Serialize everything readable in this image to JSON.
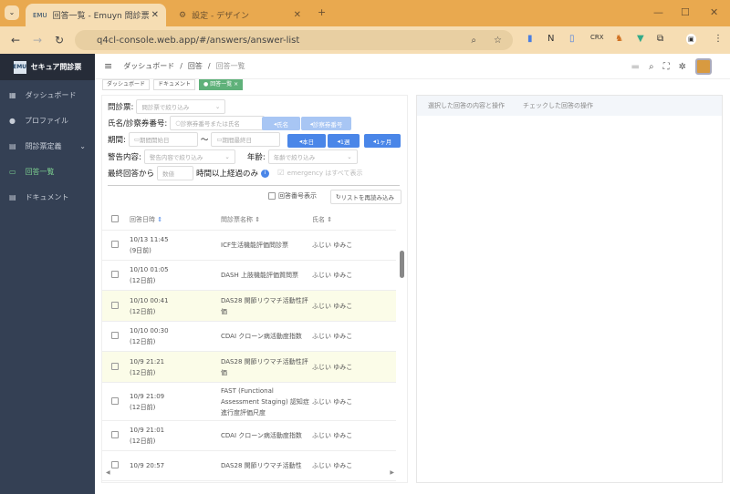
{
  "browser": {
    "tabs": [
      {
        "title": "回答一覧 - Emuyn 問診票",
        "active": true
      },
      {
        "title": "設定 - デザイン",
        "active": false
      }
    ],
    "url": "q4cl-console.web.app/#/answers/answer-list"
  },
  "sidebar": {
    "brand": "セキュア問診票",
    "logo_text": "EMUYN",
    "items": [
      {
        "label": "ダッシュボード",
        "icon": "dashboard-icon"
      },
      {
        "label": "プロファイル",
        "icon": "person-icon"
      },
      {
        "label": "問診票定義",
        "icon": "clipboard-icon"
      },
      {
        "label": "回答一覧",
        "icon": "inbox-icon",
        "active": true
      },
      {
        "label": "ドキュメント",
        "icon": "document-icon"
      }
    ]
  },
  "header": {
    "breadcrumb": [
      "ダッシュボード",
      "回答",
      "回答一覧"
    ]
  },
  "tags": [
    "ダッシュボード",
    "ドキュメント",
    "回答一覧"
  ],
  "filters": {
    "form_label": "問診票:",
    "form_placeholder": "問診票で絞り込み",
    "name_label": "氏名/診察券番号:",
    "name_placeholder": "診察券番号または氏名",
    "btn_name": "氏名",
    "btn_card": "診察券番号",
    "period_label": "期間:",
    "start_placeholder": "期間開始日",
    "tilde": "〜",
    "end_placeholder": "期間最終日",
    "btn_today": "本日",
    "btn_week": "1週",
    "btn_month": "1ヶ月",
    "warning_label": "警告内容:",
    "warning_placeholder": "警告内容で絞り込み",
    "age_label": "年齢:",
    "age_placeholder": "年齢で絞り込み",
    "last_label": "最終回答から",
    "last_placeholder": "数値",
    "hours_label": "時間以上経過のみ",
    "emergency_label": "emergency はすべて表示",
    "show_number": "回答番号表示",
    "reload": "リストを再読み込み"
  },
  "table": {
    "headers": [
      "回答日時",
      "問診票名称",
      "氏名"
    ],
    "rows": [
      {
        "date": "10/13 11:45",
        "ago": "(9日前)",
        "form": "ICF生活機能評価問診票",
        "name": "ふじい ゆみこ",
        "hl": false
      },
      {
        "date": "10/10 01:05",
        "ago": "(12日前)",
        "form": "DASH 上肢機能評価質問票",
        "name": "ふじい ゆみこ",
        "hl": false
      },
      {
        "date": "10/10 00:41",
        "ago": "(12日前)",
        "form": "DAS28 関節リウマチ活動性評価",
        "name": "ふじい ゆみこ",
        "hl": true
      },
      {
        "date": "10/10 00:30",
        "ago": "(12日前)",
        "form": "CDAI クローン病活動度指数",
        "name": "ふじい ゆみこ",
        "hl": false
      },
      {
        "date": "10/9 21:21",
        "ago": "(12日前)",
        "form": "DAS28 関節リウマチ活動性評価",
        "name": "ふじい ゆみこ",
        "hl": true
      },
      {
        "date": "10/9 21:09",
        "ago": "(12日前)",
        "form": "FAST (Functional Assessment Staging) 認知症進行度評価尺度",
        "name": "ふじい ゆみこ",
        "hl": false
      },
      {
        "date": "10/9 21:01",
        "ago": "(12日前)",
        "form": "CDAI クローン病活動度指数",
        "name": "ふじい ゆみこ",
        "hl": false
      },
      {
        "date": "10/9 20:57",
        "ago": "",
        "form": "DAS28 関節リウマチ活動性",
        "name": "ふじい ゆみこ",
        "hl": false
      }
    ]
  },
  "right_panel": {
    "tabs": [
      "選択した回答の内容と操作",
      "チェックした回答の操作"
    ]
  },
  "colors": {
    "tabbar": "#e9a94f",
    "sidebar": "#344054",
    "accent": "#4a86e8",
    "active_tag": "#5fb17a",
    "highlight_row": "#fbfce8"
  }
}
